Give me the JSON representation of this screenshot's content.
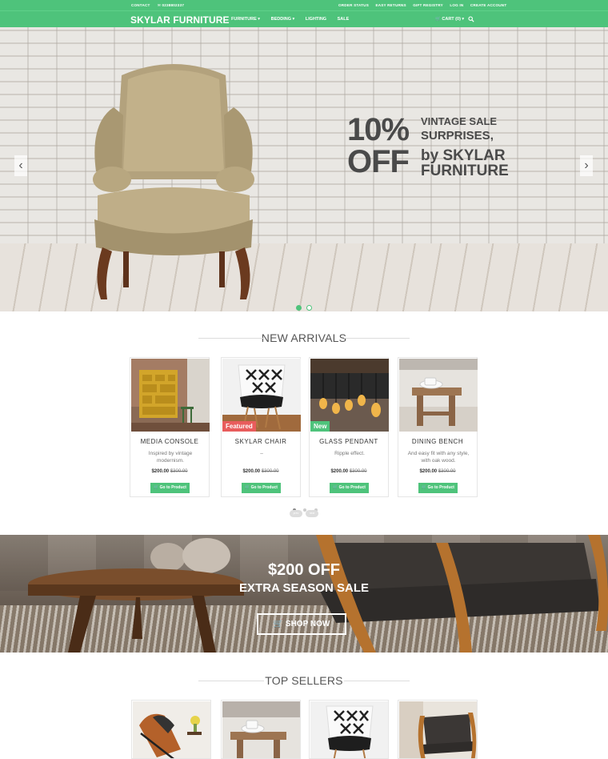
{
  "topbar": {
    "contact": "CONTACT",
    "phone": "✉ 0238802337",
    "links": [
      "ORDER STATUS",
      "EASY RETURNS",
      "GIFT REGISTRY",
      "LOG IN",
      "CREATE ACCOUNT"
    ]
  },
  "header": {
    "logo": "SKYLAR FURNITURE",
    "nav": [
      "FURNITURE ▾",
      "BEDDING ▾",
      "LIGHTING",
      "SALE"
    ],
    "cart": "🛒 CART (0) ▾"
  },
  "hero": {
    "big1": "10%",
    "big2": "OFF",
    "line1": "VINTAGE SALE",
    "line2": "SURPRISES,",
    "line3": "by SKYLAR",
    "line4": "FURNITURE",
    "prev": "‹",
    "next": "›"
  },
  "new_arrivals": {
    "title": "NEW ARRIVALS",
    "products": [
      {
        "name": "MEDIA CONSOLE",
        "desc": "Inspired by vintage modernism.",
        "price": "$200.00",
        "old_price": "$300.00",
        "button": "🛒 Go to Product",
        "badge": ""
      },
      {
        "name": "SKYLAR CHAIR",
        "desc": "–",
        "price": "$200.00",
        "old_price": "$300.00",
        "button": "🛒 Go to Product",
        "badge": "Featured"
      },
      {
        "name": "GLASS PENDANT",
        "desc": "Ripple effect.",
        "price": "$200.00",
        "old_price": "$300.00",
        "button": "🛒 Go to Product",
        "badge": "New"
      },
      {
        "name": "DINING BENCH",
        "desc": "And easy fit with any style, with oak wood.",
        "price": "$200.00",
        "old_price": "$300.00",
        "button": "🛒 Go to Product",
        "badge": ""
      }
    ],
    "prev": "prev",
    "next": "next"
  },
  "banner": {
    "line1": "$200 OFF",
    "line2": "EXTRA SEASON SALE",
    "button": "🛒 SHOP NOW"
  },
  "top_sellers": {
    "title": "TOP SELLERS"
  },
  "colors": {
    "brand_green": "#4ec37b",
    "badge_featured": "#e85c5c",
    "badge_new": "#4ec37b"
  }
}
